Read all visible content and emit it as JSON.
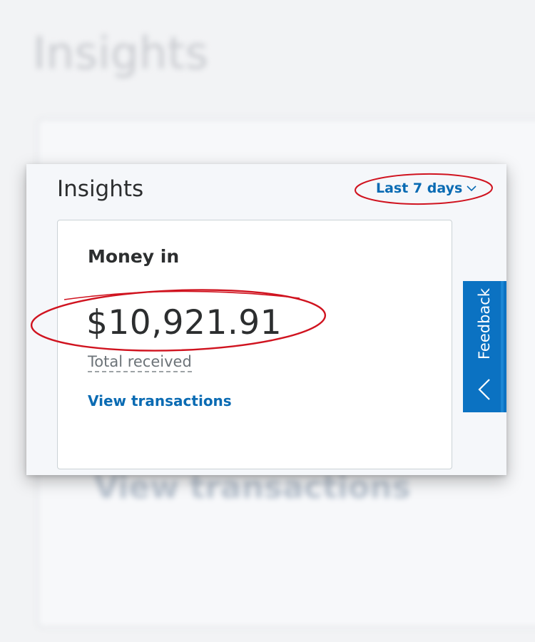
{
  "background": {
    "title": "Insights",
    "link": "View transactions"
  },
  "panel": {
    "title": "Insights",
    "range": {
      "label": "Last 7 days",
      "icon": "chevron-down-icon"
    },
    "money_card": {
      "heading": "Money in",
      "amount": "$10,921.91",
      "subtitle": "Total received",
      "link": "View transactions"
    },
    "feedback": {
      "label": "Feedback",
      "icon": "chevron-left-icon"
    }
  },
  "colors": {
    "accent": "#0a6bb3",
    "feedback_tab": "#0b72c2",
    "annotation": "#d0131f",
    "text": "#2c2e2f"
  }
}
